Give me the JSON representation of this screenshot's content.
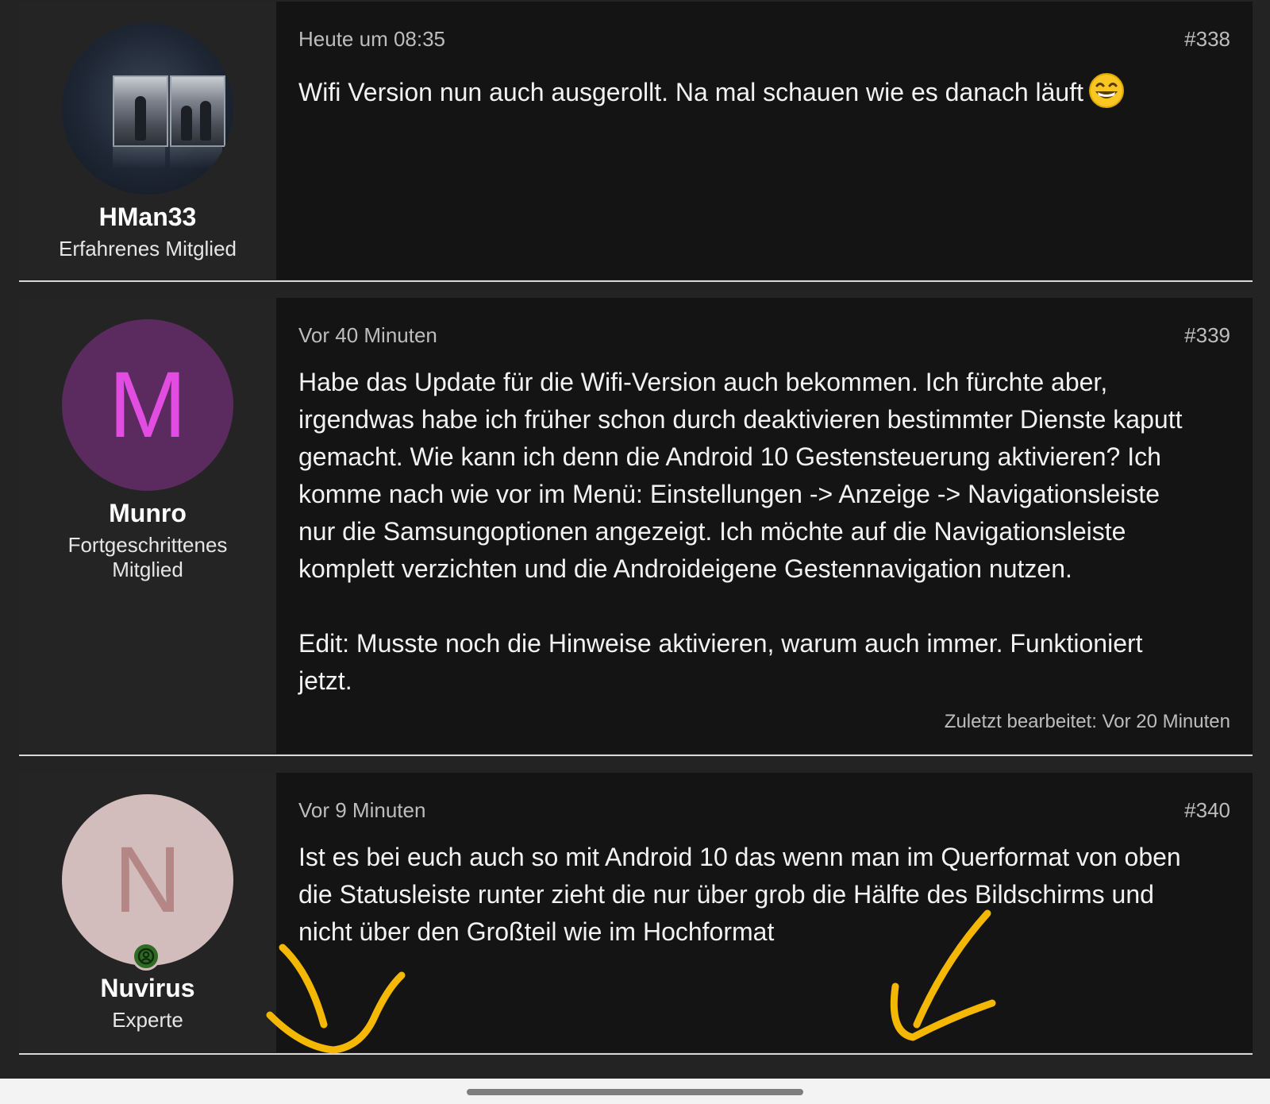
{
  "posts": [
    {
      "author": "HMan33",
      "role": "Erfahrenes Mitglied",
      "avatar": "photo",
      "time": "Heute um 08:35",
      "number": "#338",
      "text": "Wifi Version nun auch ausgerollt. Na mal schauen wie es danach läuft",
      "emoji": "grinning-face-icon"
    },
    {
      "author": "Munro",
      "role": "Fortgeschrittenes Mitglied",
      "avatar_letter": "M",
      "avatar_bg": "#5b2a5e",
      "avatar_fg": "#e04de0",
      "time": "Vor 40 Minuten",
      "number": "#339",
      "text": "Habe das Update für die Wifi-Version auch bekommen. Ich fürchte aber,\nirgendwas habe ich früher schon durch deaktivieren bestimmter Dienste kaputt\ngemacht. Wie kann ich denn die Android 10 Gestensteuerung aktivieren? Ich\nkomme nach wie vor im Menü: Einstellungen -> Anzeige -> Navigationsleiste\nnur die Samsungoptionen angezeigt. Ich möchte auf die Navigationsleiste\nkomplett verzichten und die Androideigene Gestennavigation nutzen.\n\nEdit: Musste noch die Hinweise aktivieren, warum auch immer. Funktioniert\njetzt.",
      "edited": "Zuletzt bearbeitet: Vor 20 Minuten"
    },
    {
      "author": "Nuvirus",
      "role": "Experte",
      "avatar_letter": "N",
      "avatar_bg": "#d2bcbc",
      "avatar_fg": "#b48686",
      "online_badge": "user-online-icon",
      "time": "Vor 9 Minuten",
      "number": "#340",
      "text": "Ist es bei euch auch so mit Android 10 das wenn man im Querformat von oben\ndie Statusleiste runter zieht die nur über grob die Hälfte des Bildschirms und\nnicht über den Großteil wie im Hochformat"
    }
  ],
  "annotations": {
    "color": "#f5b800",
    "marks": [
      "checkmark-annotation",
      "arrow-annotation"
    ]
  }
}
